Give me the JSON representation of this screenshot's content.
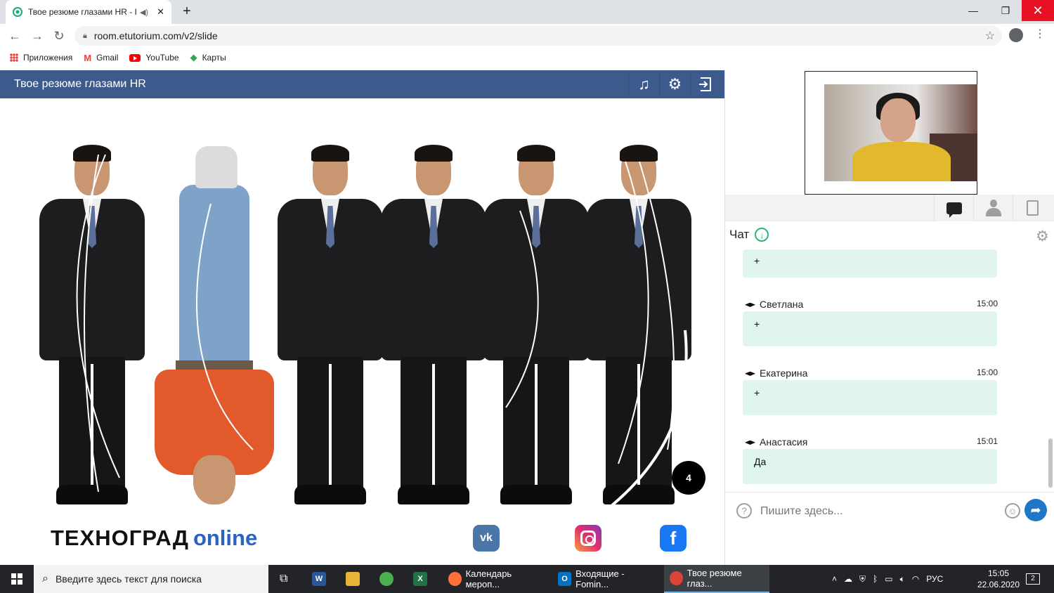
{
  "browser": {
    "tab_title": "Твое резюме глазами HR - I",
    "url": "room.etutorium.com/v2/slide",
    "bookmarks": [
      "Приложения",
      "Gmail",
      "YouTube",
      "Карты"
    ]
  },
  "app": {
    "header_title": "Твое резюме глазами HR"
  },
  "slide": {
    "page_number": "4",
    "brand_main": "ТЕХНОГРАД",
    "brand_suffix": "online",
    "vk_label": "vk",
    "fb_label": "f"
  },
  "chat": {
    "heading": "Чат",
    "messages": [
      {
        "author": "",
        "time": "",
        "text": "+"
      },
      {
        "author": "Светлана",
        "time": "15:00",
        "text": "+"
      },
      {
        "author": "Екатерина",
        "time": "15:00",
        "text": "+"
      },
      {
        "author": "Анастасия",
        "time": "15:01",
        "text": "Да"
      }
    ],
    "input_placeholder": "Пишите здесь..."
  },
  "taskbar": {
    "search_placeholder": "Введите здесь текст для поиска",
    "apps": [
      {
        "label": "Календарь мероп...",
        "icon": "firefox-icon"
      },
      {
        "label": "Входящие - Fomin...",
        "icon": "outlook-icon"
      },
      {
        "label": "Твое резюме глаз...",
        "icon": "chrome-icon"
      }
    ],
    "lang": "РУС",
    "time": "15:05",
    "date": "22.06.2020",
    "notifications": "2"
  },
  "colors": {
    "header": "#3c5a8c",
    "bubble": "#e0f5ec",
    "brand_accent": "#2b63c2",
    "send": "#1f77c8"
  }
}
